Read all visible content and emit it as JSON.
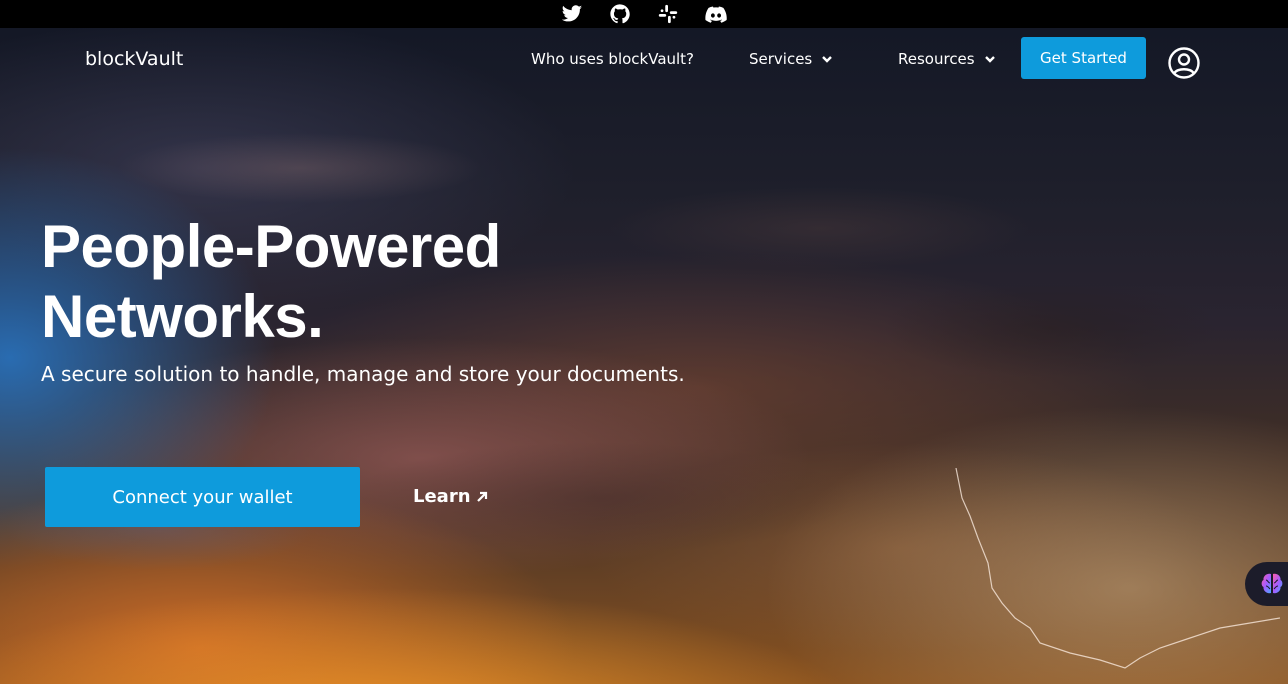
{
  "topbar": {
    "icons": [
      "twitter-icon",
      "github-icon",
      "slack-icon",
      "discord-icon"
    ]
  },
  "navbar": {
    "brand": "blockVault",
    "links": [
      {
        "label": "Who uses blockVault?",
        "has_dropdown": false
      },
      {
        "label": "Services",
        "has_dropdown": true
      },
      {
        "label": "Resources",
        "has_dropdown": true
      }
    ],
    "cta_label": "Get Started",
    "user_icon": "user-circle-icon"
  },
  "hero": {
    "headline_line1": "People-Powered",
    "headline_line2": "Networks.",
    "subline": "A secure solution to handle, manage and store your documents.",
    "primary_button": "Connect your wallet",
    "secondary_link": "Learn",
    "secondary_icon": "arrow-up-right-icon"
  },
  "widget": {
    "icon": "brain-icon"
  },
  "colors": {
    "accent": "#0e9bdc",
    "topbar_bg": "#000000",
    "text": "#ffffff"
  }
}
